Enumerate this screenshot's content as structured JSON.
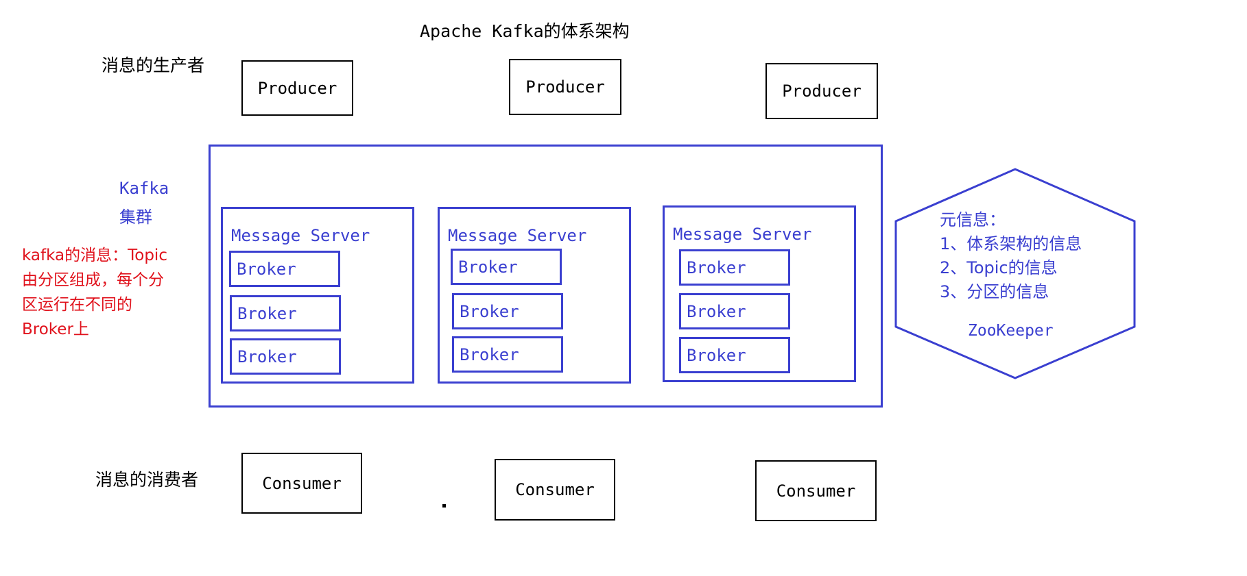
{
  "title": "Apache Kafka的体系架构",
  "labels": {
    "producers": "消息的生产者",
    "consumers": "消息的消费者",
    "cluster_line1": "Kafka",
    "cluster_line2": "集群"
  },
  "producers": [
    "Producer",
    "Producer",
    "Producer"
  ],
  "consumers": [
    "Consumer",
    "Consumer",
    "Consumer"
  ],
  "servers": [
    {
      "label": "Message Server",
      "brokers": [
        "Broker",
        "Broker",
        "Broker"
      ]
    },
    {
      "label": "Message Server",
      "brokers": [
        "Broker",
        "Broker",
        "Broker"
      ]
    },
    {
      "label": "Message Server",
      "brokers": [
        "Broker",
        "Broker",
        "Broker"
      ]
    }
  ],
  "note_lines": [
    "kafka的消息：Topic",
    "由分区组成，每个分",
    "区运行在不同的",
    "Broker上"
  ],
  "zookeeper": {
    "lines": [
      "元信息：",
      "1、体系架构的信息",
      "2、Topic的信息",
      "3、分区的信息"
    ],
    "name": "ZooKeeper"
  },
  "colors": {
    "accent": "#3a3fd0",
    "note": "#e0121c",
    "stroke": "#000000"
  }
}
